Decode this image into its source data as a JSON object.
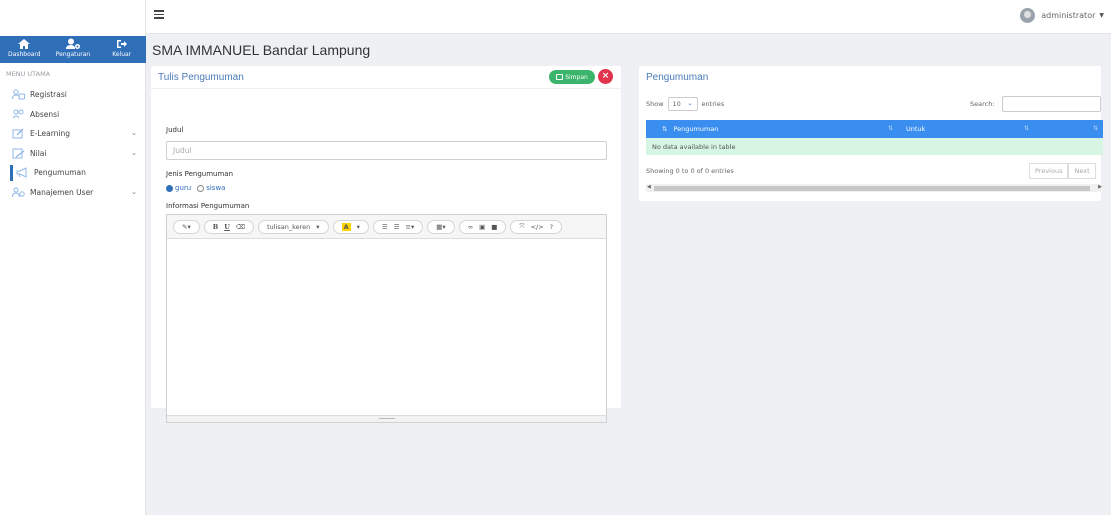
{
  "topbar": {
    "username": "administrator"
  },
  "sidebar": {
    "nav": [
      {
        "label": "Dashboard",
        "icon": "home-icon"
      },
      {
        "label": "Pengaturan",
        "icon": "users-cog-icon"
      },
      {
        "label": "Keluar",
        "icon": "sign-out-icon"
      }
    ],
    "menu_title": "MENU UTAMA",
    "items": [
      {
        "label": "Registrasi",
        "icon": "registration-icon",
        "has_submenu": false
      },
      {
        "label": "Absensi",
        "icon": "attendance-icon",
        "has_submenu": false
      },
      {
        "label": "E-Learning",
        "icon": "elearning-icon",
        "has_submenu": true
      },
      {
        "label": "Nilai",
        "icon": "grades-icon",
        "has_submenu": true
      },
      {
        "label": "Pengumuman",
        "icon": "announcement-icon",
        "has_submenu": false,
        "active": true
      },
      {
        "label": "Manajemen User",
        "icon": "user-management-icon",
        "has_submenu": true
      }
    ]
  },
  "page": {
    "title": "SMA IMMANUEL Bandar Lampung"
  },
  "form": {
    "title": "Tulis Pengumuman",
    "save_label": "Simpan",
    "close_label": "×",
    "judul_label": "Judul",
    "judul_placeholder": "Judul",
    "jenis_label": "Jenis Pengumuman",
    "jenis_options": [
      "guru",
      "siswa"
    ],
    "jenis_selected": "guru",
    "info_label": "Informasi Pengumuman",
    "editor_font_select": "tulisan_keren"
  },
  "table_panel": {
    "title": "Pengumuman",
    "show_label": "Show",
    "entries_value": "10",
    "entries_label": "entries",
    "search_label": "Search:",
    "columns": [
      "Pengumuman",
      "Untuk",
      ""
    ],
    "empty_text": "No data available in table",
    "info_text": "Showing 0 to 0 of 0 entries",
    "prev_label": "Previous",
    "next_label": "Next"
  },
  "colors": {
    "primary": "#2f6fb8",
    "table_header": "#3a8ef0",
    "save_button": "#3bb56b",
    "close_button": "#e0344d",
    "empty_row": "#d6f5e3"
  }
}
